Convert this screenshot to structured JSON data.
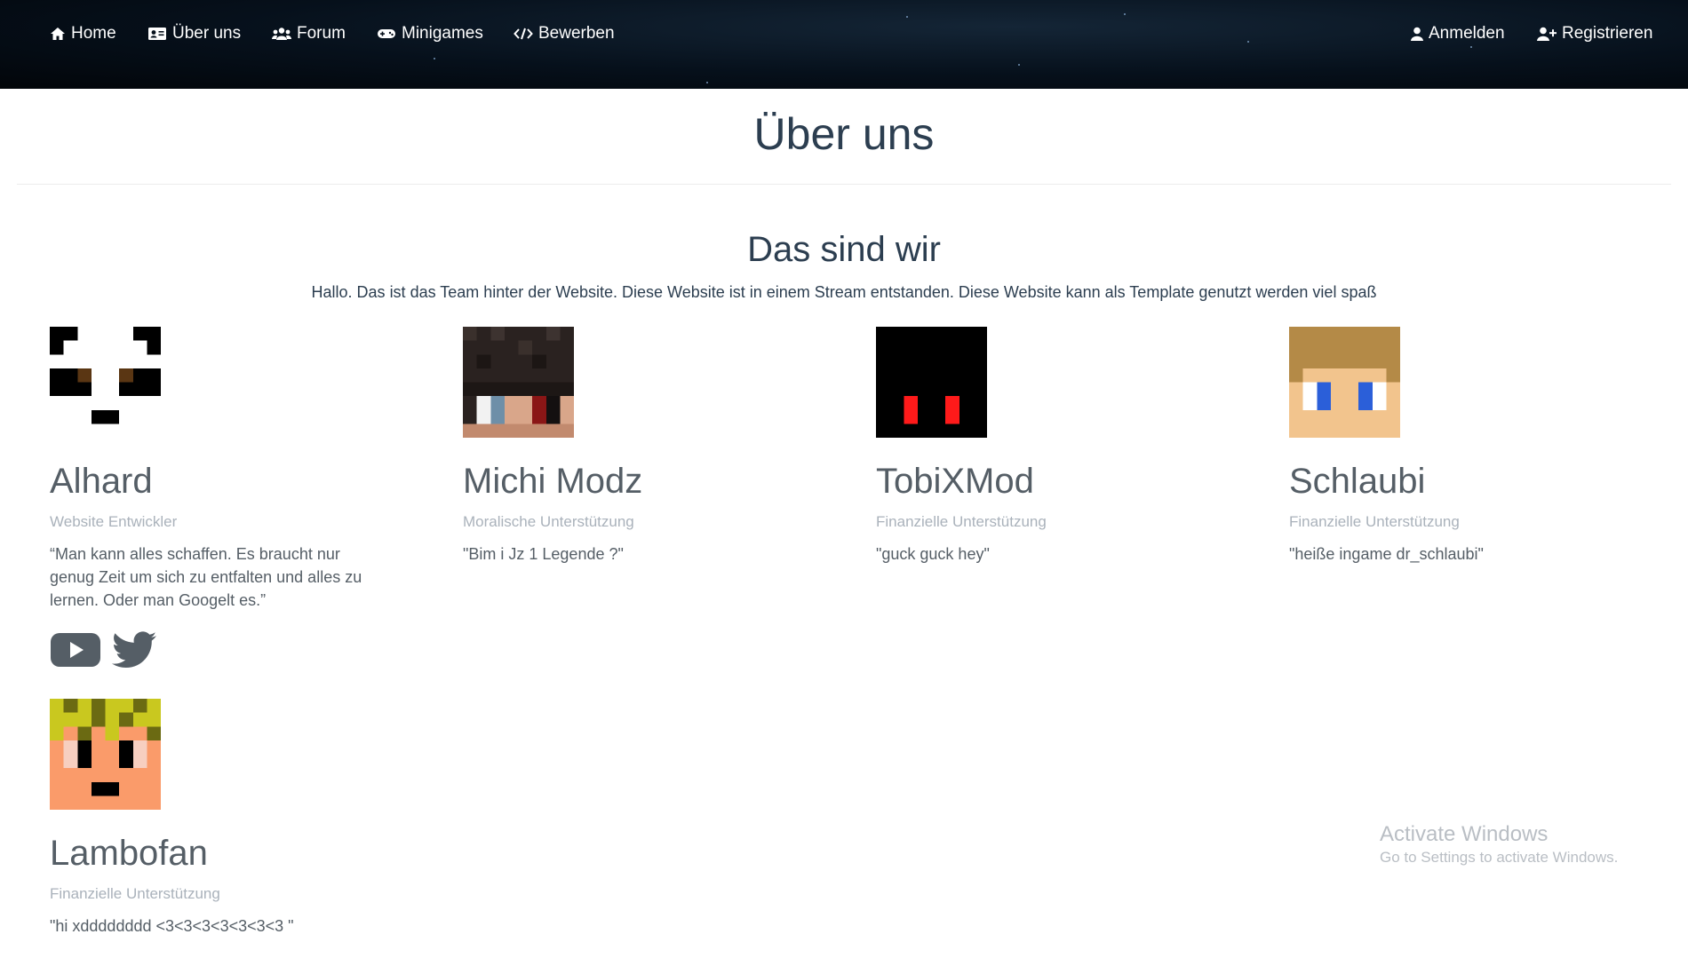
{
  "nav": {
    "home": "Home",
    "about": "Über uns",
    "forum": "Forum",
    "minigames": "Minigames",
    "apply": "Bewerben",
    "login": "Anmelden",
    "register": "Registrieren"
  },
  "page": {
    "title": "Über uns",
    "section_title": "Das sind wir",
    "intro": "Hallo. Das ist das Team hinter der Website. Diese Website ist in einem Stream entstanden. Diese Website kann als Template genutzt werden viel spaß"
  },
  "team": [
    {
      "name": "Alhard",
      "role": "Website Entwickler",
      "quote": "“Man kann alles schaffen. Es braucht nur genug Zeit um sich zu entfalten und alles zu lernen. Oder man Googelt es.”",
      "avatar": "panda-skin-icon",
      "socials": [
        "youtube-icon",
        "twitter-icon"
      ]
    },
    {
      "name": "Michi Modz",
      "role": "Moralische Unterstützung",
      "quote": "\"Bim i Jz 1 Legende ?\"",
      "avatar": "dark-hair-skin-icon"
    },
    {
      "name": "TobiXMod",
      "role": "Finanzielle Unterstützung",
      "quote": "\"guck guck hey\"",
      "avatar": "black-red-eyes-skin-icon"
    },
    {
      "name": "Schlaubi",
      "role": "Finanzielle Unterstützung",
      "quote": "\"heiße ingame dr_schlaubi\"",
      "avatar": "blonde-blue-eyes-skin-icon"
    },
    {
      "name": "Lambofan",
      "role": "Finanzielle Unterstützung",
      "quote": "\"hi xdddddddd <3<3<3<3<3<3<3 \"",
      "avatar": "yellow-hair-skin-icon"
    }
  ],
  "watermark": {
    "title": "Activate Windows",
    "subtitle": "Go to Settings to activate Windows."
  },
  "colors": {
    "nav_bg": "#06101b",
    "text_dark": "#2c3e50",
    "text_muted": "#aab2bb",
    "text_body": "#555e66"
  }
}
